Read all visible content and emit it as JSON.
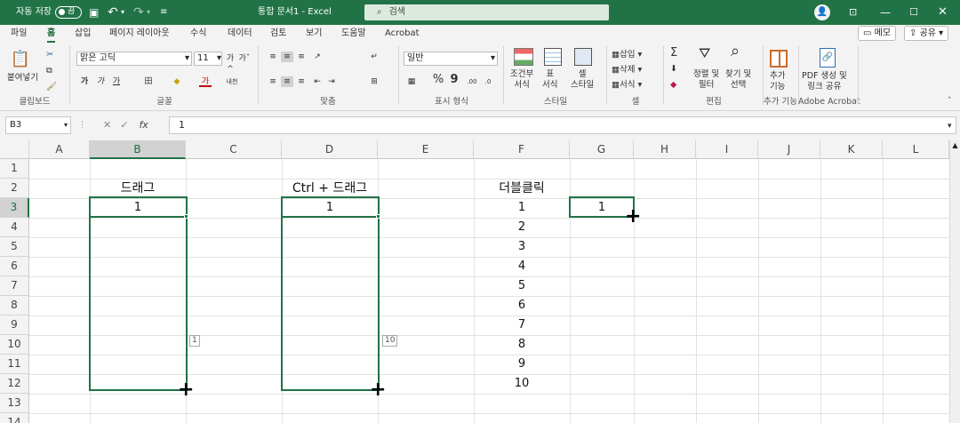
{
  "titlebar": {
    "autosave_label": "자동 저장",
    "autosave_state": "끔",
    "undo_icon": "undo-icon",
    "redo_icon": "redo-icon",
    "title": "통합 문서1 - Excel",
    "search_placeholder": "검색",
    "avatar_initial": "",
    "window_controls": [
      "restore-ribbon-icon",
      "minimize-icon",
      "maximize-icon",
      "close-icon"
    ]
  },
  "tabs": [
    "파일",
    "홈",
    "삽입",
    "페이지 레이아웃",
    "수식",
    "데이터",
    "검토",
    "보기",
    "도움말",
    "Acrobat"
  ],
  "active_tab": "홈",
  "actions": {
    "memo": "메모",
    "share": "공유"
  },
  "ribbon": {
    "clipboard": {
      "paste": "붙여넣기",
      "label": "클립보드"
    },
    "font": {
      "name": "맑은 고딕",
      "size": "11",
      "bold": "가",
      "italic": "가",
      "underline": "가",
      "font_color_letter": "가",
      "label": "글꼴"
    },
    "align": {
      "label": "맞춤"
    },
    "number": {
      "format": "일반",
      "percent": "%",
      "comma": "9",
      "label": "표시 형식"
    },
    "styles": {
      "conditional": "조건부\n서식",
      "table": "표\n서식",
      "cell": "셀\n스타일",
      "label": "스타일"
    },
    "cells": {
      "insert": "삽입",
      "delete": "삭제",
      "format": "서식",
      "label": "셀"
    },
    "editing": {
      "sum": "Σ",
      "sort": "정렬 및\n필터",
      "find": "찾기 및\n선택",
      "label": "편집"
    },
    "addins": {
      "button": "추가\n기능",
      "label": "추가 기능"
    },
    "acrobat": {
      "button": "PDF 생성 및\n링크 공유",
      "label": "Adobe Acrobat"
    }
  },
  "formula_bar": {
    "name_box": "B3",
    "fx": "fx",
    "value": "1"
  },
  "columns": [
    "A",
    "B",
    "C",
    "D",
    "E",
    "F",
    "G",
    "H",
    "I",
    "J",
    "K",
    "L"
  ],
  "selected_column": "B",
  "rows": [
    "1",
    "2",
    "3",
    "4",
    "5",
    "6",
    "7",
    "8",
    "9",
    "10",
    "11",
    "12",
    "13",
    "14"
  ],
  "selected_row": "3",
  "cells": {
    "B2": "드래그",
    "D2": "Ctrl + 드래그",
    "F2": "더블클릭",
    "B3": "1",
    "D3": "1",
    "F3": "1",
    "F4": "2",
    "F5": "3",
    "F6": "4",
    "F7": "5",
    "F8": "6",
    "F9": "7",
    "F10": "8",
    "F11": "9",
    "F12": "10",
    "G3": "1"
  },
  "fill_tooltips": {
    "B": "1",
    "D": "10"
  }
}
